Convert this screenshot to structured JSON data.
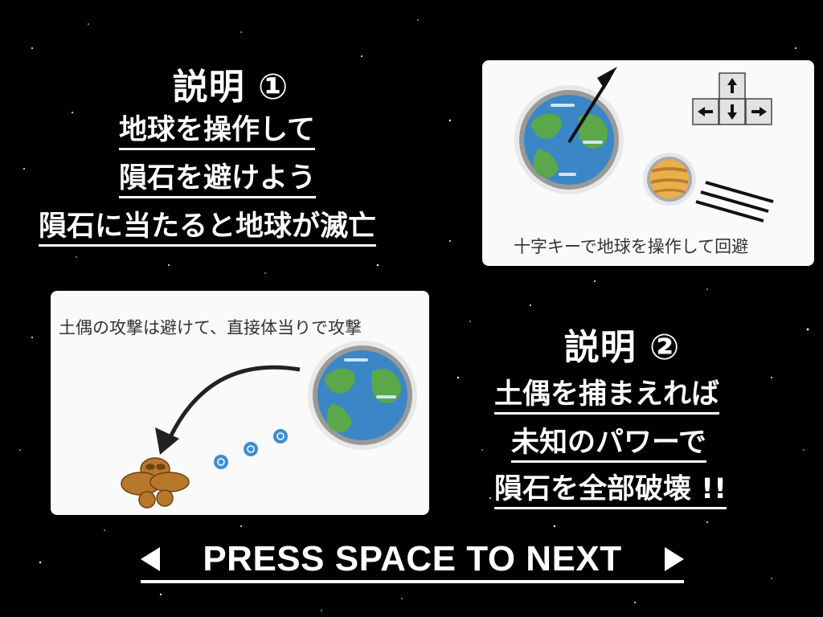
{
  "section1": {
    "title": "説明 ①",
    "lines": [
      "地球を操作して",
      "隕石を避けよう",
      "隕石に当たると地球が滅亡"
    ]
  },
  "panel1": {
    "caption": "十字キーで地球を操作して回避"
  },
  "panel2": {
    "caption": "土偶の攻撃は避けて、直接体当りで攻撃"
  },
  "section2": {
    "title": "説明 ②",
    "lines": [
      "土偶を捕まえれば",
      "未知のパワーで",
      "隕石を全部破壊 !!"
    ]
  },
  "footer": {
    "press_label": "PRESS SPACE TO NEXT"
  },
  "colors": {
    "background": "#000000",
    "panel": "#fafafa",
    "ocean": "#3a86c6",
    "land": "#5aa84a",
    "meteor": "#e8b04a",
    "dogu": "#b7782c"
  },
  "icons": [
    "earth-icon",
    "arrow-key-icon",
    "meteor-icon",
    "dogu-icon",
    "energy-orb-icon"
  ]
}
